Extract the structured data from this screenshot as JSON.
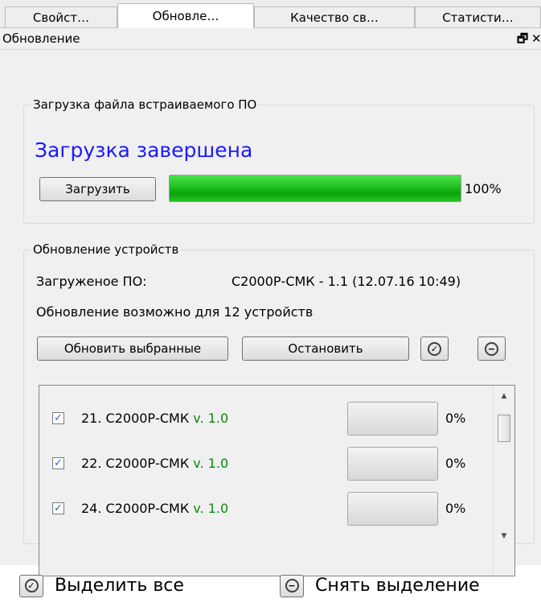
{
  "tabs": [
    {
      "label": "Свойст…",
      "active": false
    },
    {
      "label": "Обновле…",
      "active": true
    },
    {
      "label": "Качество св…",
      "active": false
    },
    {
      "label": "Статисти…",
      "active": false
    }
  ],
  "window": {
    "title": "Обновление",
    "float_icon": "float-window-icon",
    "close_icon": "close-icon"
  },
  "firmware_group": {
    "legend": "Загрузка файла встраиваемого ПО",
    "status": "Загрузка завершена",
    "status_color": "#1a1aff",
    "load_button": "Загрузить",
    "progress_value": 100,
    "progress_label": "100%",
    "progress_color": "#1ec11e"
  },
  "devices_group": {
    "legend": "Обновление устройств",
    "loaded_label": "Загруженое ПО:",
    "loaded_value": "С2000Р-СМК - 1.1 (12.07.16 10:49)",
    "update_possible": "Обновление возможно для 12 устройств",
    "update_selected_button": "Обновить выбранные",
    "stop_button": "Остановить",
    "select_all_icon": "select-all-icon",
    "deselect_icon": "deselect-icon",
    "devices": [
      {
        "name": "21. С2000Р-СМК",
        "version": "v. 1.0",
        "checked": true,
        "progress": 0,
        "progress_label": "0%"
      },
      {
        "name": "22. С2000Р-СМК",
        "version": "v. 1.0",
        "checked": true,
        "progress": 0,
        "progress_label": "0%"
      },
      {
        "name": "24. С2000Р-СМК",
        "version": "v. 1.0",
        "checked": true,
        "progress": 0,
        "progress_label": "0%"
      }
    ]
  },
  "legend_bottom": {
    "select_all": "Выделить все",
    "deselect": "Снять выделение"
  }
}
